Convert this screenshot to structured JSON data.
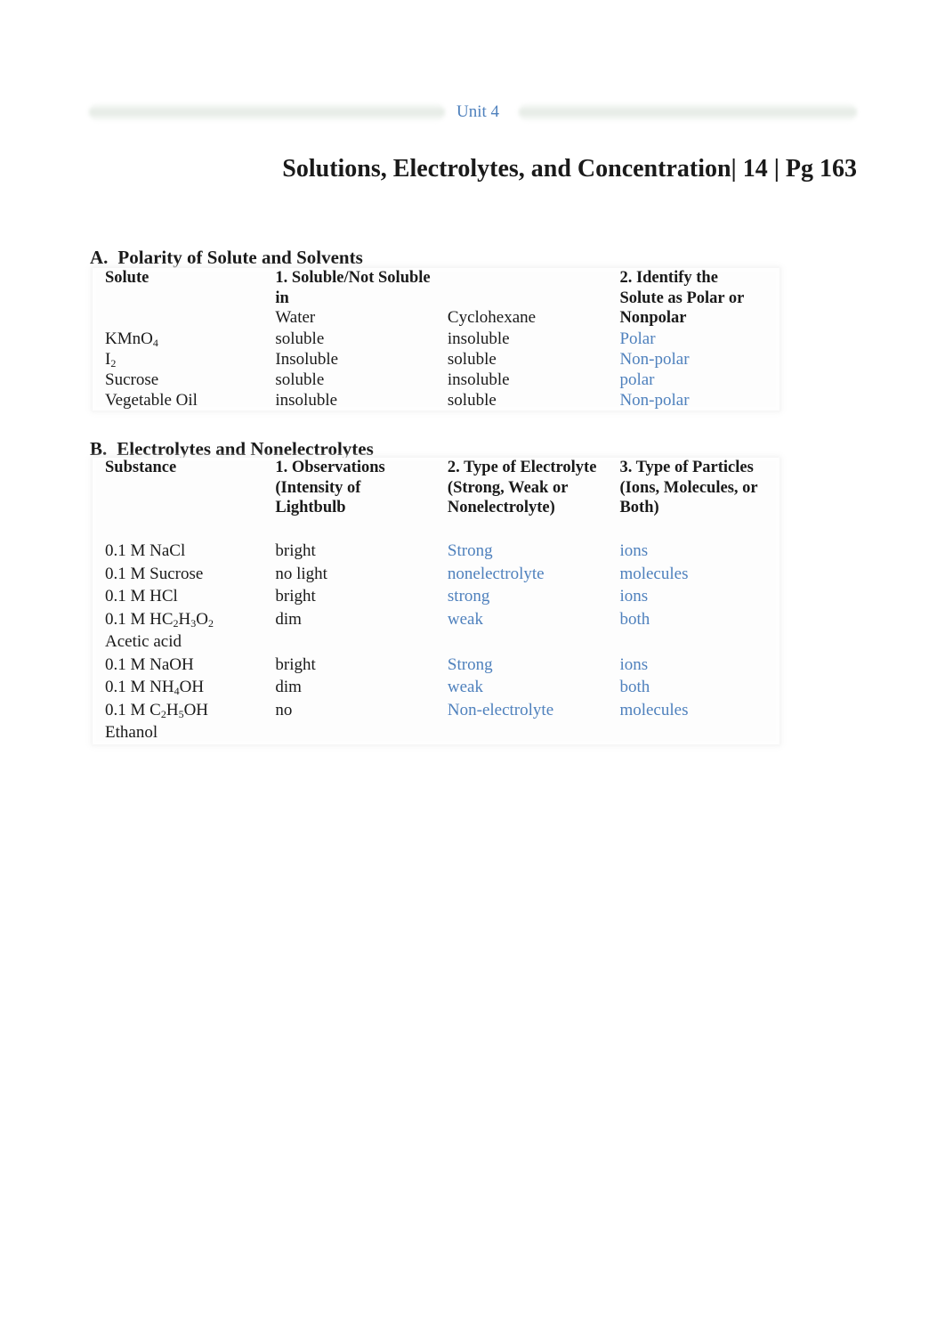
{
  "header": {
    "unit_label": "Unit 4",
    "page_title": "Solutions, Electrolytes, and Concentration| 14 | Pg 163"
  },
  "section_a": {
    "letter": "A.",
    "title": "Polarity of Solute and Solvents",
    "headers": {
      "col1": "Solute",
      "col2": "1. Soluble/Not Soluble in",
      "col4": "2. Identify the Solute as Polar or Nonpolar"
    },
    "subheaders": {
      "col2": "Water",
      "col3": "Cyclohexane",
      "col4": "Nonpolar"
    },
    "col4_header_lines": [
      "2. Identify the",
      "Solute as Polar or",
      "Nonpolar"
    ],
    "rows": [
      {
        "solute": "KMnO",
        "solute_sub": "4",
        "water": "soluble",
        "cyclohexane": "insoluble",
        "polarity": "Polar"
      },
      {
        "solute": "I",
        "solute_sub": "2",
        "water": "Insoluble",
        "cyclohexane": "soluble",
        "polarity": "Non-polar"
      },
      {
        "solute": "Sucrose",
        "solute_sub": "",
        "water": "soluble",
        "cyclohexane": "insoluble",
        "polarity": "polar"
      },
      {
        "solute": "Vegetable Oil",
        "solute_sub": "",
        "water": "insoluble",
        "cyclohexane": "soluble",
        "polarity": "Non-polar"
      }
    ]
  },
  "section_b": {
    "letter": "B.",
    "title": "Electrolytes and Nonelectrolytes",
    "headers": {
      "col1": "Substance",
      "col2": "1. Observations (Intensity of Lightbulb",
      "col3": "2. Type of Electrolyte (Strong, Weak or Nonelectrolyte)",
      "col4": "3. Type of Particles (Ions, Molecules, or Both)"
    },
    "rows": [
      {
        "substance_parts": [
          "0.1 M NaCl"
        ],
        "substance_name": "",
        "observation": "bright",
        "electrolyte_type": "Strong",
        "particles": "ions"
      },
      {
        "substance_parts": [
          "0.1 M Sucrose"
        ],
        "substance_name": "",
        "observation": "no light",
        "electrolyte_type": "nonelectrolyte",
        "particles": "molecules"
      },
      {
        "substance_parts": [
          "0.1 M HCl"
        ],
        "substance_name": "",
        "observation": "bright",
        "electrolyte_type": "strong",
        "particles": "ions"
      },
      {
        "substance_parts": [
          "0.1 M HC",
          "2",
          "H",
          "3",
          "O",
          "2"
        ],
        "substance_name": "Acetic acid",
        "observation": "dim",
        "electrolyte_type": "weak",
        "particles": "both"
      },
      {
        "substance_parts": [
          "0.1 M NaOH"
        ],
        "substance_name": "",
        "observation": "bright",
        "electrolyte_type": "Strong",
        "particles": "ions"
      },
      {
        "substance_parts": [
          "0.1 M NH",
          "4",
          "OH"
        ],
        "substance_name": "",
        "observation": "dim",
        "electrolyte_type": "weak",
        "particles": "both"
      },
      {
        "substance_parts": [
          "0.1 M C",
          "2",
          "H",
          "5",
          "OH"
        ],
        "substance_name": "Ethanol",
        "observation": "no",
        "electrolyte_type": "Non-electrolyte",
        "particles": "molecules"
      }
    ]
  },
  "colors": {
    "answer_text": "#4f81bd",
    "body_text": "#1a1a1a"
  }
}
